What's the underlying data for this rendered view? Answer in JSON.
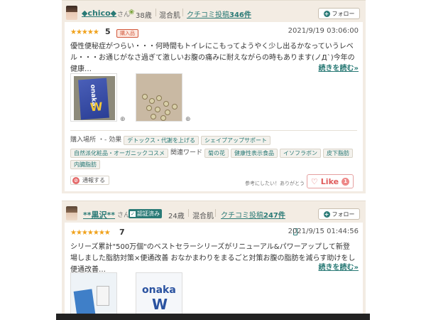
{
  "reviews": [
    {
      "user_name": "◆chico◆",
      "honorific": "さん",
      "age": "38歳",
      "skin": "混合肌",
      "kuchikomi_label": "クチコミ投稿",
      "kuchikomi_count": "346件",
      "follow_label": "フォロー",
      "rating": 5,
      "stars": "★★★★★",
      "score": "5",
      "badge": "購入品",
      "date": "2021/9/19 03:06:00",
      "text": "優性便秘症がつらい・・・何時間もトイレにこもってようやく少し出るかなっていうレベル・・・お通じがなさ過ぎて激しいお腹の痛みに耐えながらの時もあります(ノД`)今年の健康…",
      "read_more": "続きを読む»",
      "tags": {
        "purchase_label": "購入場所",
        "purchase_value": "・-",
        "effect_label": "効果",
        "effects": [
          "デトックス・代謝を上げる",
          "シェイプアップサポート"
        ],
        "row2_tags": [
          "自然派化粧品・オーガニックコスメ"
        ],
        "related_label": "関連ワード",
        "related": [
          "菊の花",
          "健康性表示食品",
          "イソフラボン",
          "皮下脂肪",
          "内臓脂肪"
        ]
      },
      "report_label": "通報する",
      "helpful_text": "参考にしたい！ありがとう",
      "like_label": "Like",
      "like_count": "1"
    },
    {
      "user_name": "**黒沢**",
      "honorific": "さん",
      "verified": "認証済み",
      "age": "24歳",
      "skin": "混合肌",
      "kuchikomi_label": "クチコミ投稿",
      "kuchikomi_count": "247件",
      "follow_label": "フォロー",
      "rating": 7,
      "stars": "★★★★★★★",
      "score": "7",
      "date": "2021/9/15 01:44:56",
      "text": "シリーズ累計\"500万個\"のベストセラーシリーズがリニューアル&パワーアップして新登場しました脂肪対策×便通改善 おなかまわりをまるごと対策お腹の脂肪を減らす助けをし便通改善…",
      "read_more": "続きを読む»"
    }
  ],
  "icons": {
    "zoom": "magnifier-plus-icon",
    "follow": "plus-icon",
    "report": "prohibit-icon",
    "like": "heart-icon",
    "device": "smartphone-icon"
  },
  "colors": {
    "accent": "#2a7a76",
    "star": "#f0a21c",
    "like": "#e05a5a",
    "card_bg": "#f3ece3"
  }
}
